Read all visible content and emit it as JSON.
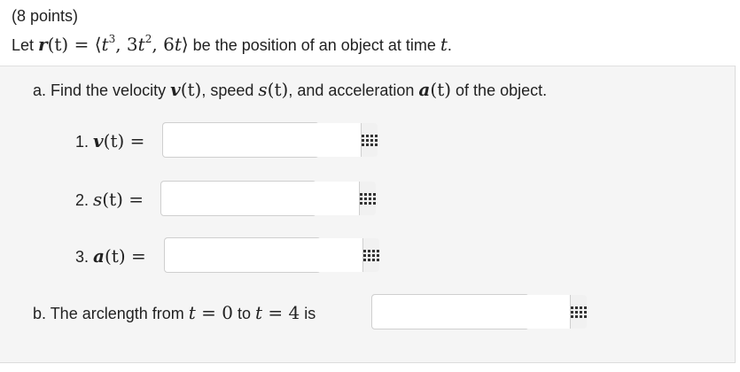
{
  "header": {
    "points": "(8 points)"
  },
  "intro": {
    "lead": "Let ",
    "vector_r": "r",
    "arg_t": "(t)",
    "equals": " = ",
    "expression_open": "⟨",
    "t3_base": "t",
    "t3_exp": "3",
    "comma1": ", 3",
    "t2_base": "t",
    "t2_exp": "2",
    "comma2": ", 6",
    "t_last": "t",
    "expression_close": "⟩",
    "tail": " be the position of an object at time ",
    "time_var": "t",
    "period": "."
  },
  "part_a": {
    "lead": "a. Find the velocity ",
    "v_sym": "v",
    "v_arg": "(t)",
    "sep1": ", speed ",
    "s_sym": "s",
    "s_arg": "(t)",
    "sep2": ", and acceleration ",
    "a_sym": "a",
    "a_arg": "(t)",
    "tail": " of the object."
  },
  "items": [
    {
      "number": "1. ",
      "symbol": "v",
      "arg": "(t)",
      "equals": " =",
      "value": "",
      "placeholder": ""
    },
    {
      "number": "2. ",
      "symbol": "s",
      "arg": "(t)",
      "equals": " =",
      "value": "",
      "placeholder": ""
    },
    {
      "number": "3. ",
      "symbol": "a",
      "arg": "(t)",
      "equals": " =",
      "value": "",
      "placeholder": ""
    }
  ],
  "part_b": {
    "lead": "b. The arclength from ",
    "t_var1": "t",
    "eq1": " = 0",
    "to": " to ",
    "t_var2": "t",
    "eq2": " = 4",
    "tail": " is",
    "value": "",
    "placeholder": ""
  },
  "icons": {
    "palette": "grid-icon"
  },
  "colors": {
    "panel_bg": "#f5f5f5",
    "text": "#222222",
    "input_border": "#cfcfcf",
    "button_bg": "#f1f1f1"
  }
}
